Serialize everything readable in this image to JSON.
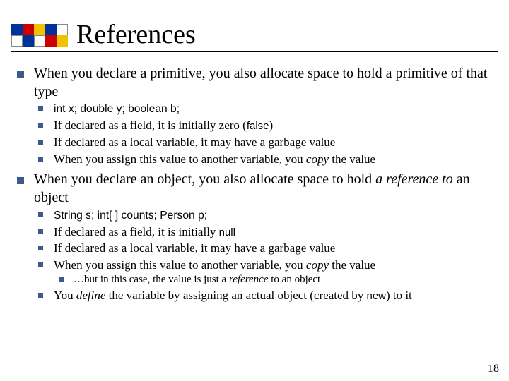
{
  "title": "References",
  "page_number": "18",
  "points": {
    "p1": {
      "text_a": "When you declare a primitive, you also allocate space to hold a primitive of that type",
      "sub": {
        "s1": "int x; double y; boolean b;",
        "s2_a": "If declared as a field, it is initially zero (",
        "s2_b": "false",
        "s2_c": ")",
        "s3": "If declared as a local variable, it may have a garbage value",
        "s4_a": "When you assign this value to another variable, you ",
        "s4_b": "copy",
        "s4_c": " the value"
      }
    },
    "p2": {
      "text_a": "When you declare an object, you also allocate space to hold ",
      "text_b": "a reference to",
      "text_c": " an object",
      "sub": {
        "s1": "String s; int[ ] counts; Person p;",
        "s2_a": "If declared as a field, it is initially ",
        "s2_b": "null",
        "s3": "If declared as a local variable, it may have a garbage value",
        "s4_a": "When you assign this value to another variable, you ",
        "s4_b": "copy",
        "s4_c": " the value",
        "s4_sub_a": "…but in this case, the value is just a ",
        "s4_sub_b": "reference",
        "s4_sub_c": " to an object",
        "s5_a": "You ",
        "s5_b": "define",
        "s5_c": " the variable by assigning an actual object (created by ",
        "s5_d": "new",
        "s5_e": ") to it"
      }
    }
  }
}
